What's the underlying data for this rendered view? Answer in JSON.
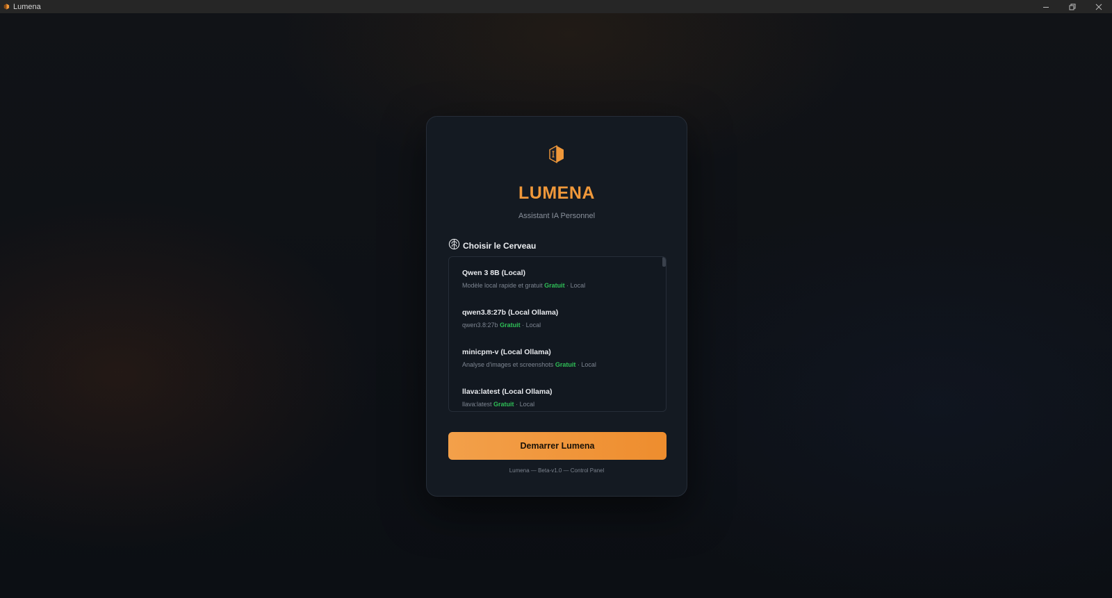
{
  "window": {
    "title": "Lumena",
    "app_icon": "lumena-logo-icon",
    "controls": [
      "minimize-icon",
      "restore-icon",
      "close-icon"
    ]
  },
  "brand": {
    "name": "LUMENA",
    "subtitle": "Assistant IA Personnel",
    "accent_color": "#f0983a",
    "logo_icon": "hexagon-logo-icon"
  },
  "model_section": {
    "icon": "brain-icon",
    "label": "Choisir le Cerveau",
    "models": [
      {
        "name": "Qwen 3 8B (Local)",
        "description": "Modèle local rapide et gratuit",
        "price": "Gratuit",
        "location": "· Local"
      },
      {
        "name": "qwen3.8:27b (Local Ollama)",
        "description": "qwen3.8:27b",
        "price": "Gratuit",
        "location": "· Local"
      },
      {
        "name": "minicpm-v (Local Ollama)",
        "description": "Analyse d'images et screenshots",
        "price": "Gratuit",
        "location": "· Local"
      },
      {
        "name": "llava:latest (Local Ollama)",
        "description": "llava:latest",
        "price": "Gratuit",
        "location": "· Local"
      }
    ],
    "free_color": "#2fbf57"
  },
  "start_button": {
    "label": "Demarrer Lumena"
  },
  "footer": {
    "text": "Lumena — Beta-v1.0 — Control Panel"
  }
}
